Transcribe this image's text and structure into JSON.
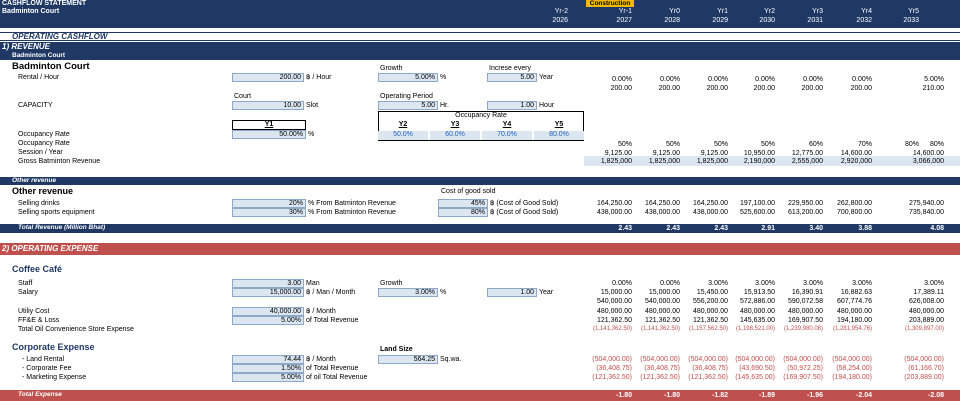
{
  "header": {
    "title": "CASHFLOW STATEMENT",
    "subtitle": "Badminton Court",
    "construction": "Construction",
    "years": [
      {
        "label": "Yr-2",
        "year": "2026"
      },
      {
        "label": "Yr-1",
        "year": "2027"
      },
      {
        "label": "Yr0",
        "year": "2028"
      },
      {
        "label": "Yr1",
        "year": "2029"
      },
      {
        "label": "Yr2",
        "year": "2030"
      },
      {
        "label": "Yr3",
        "year": "2031"
      },
      {
        "label": "Yr4",
        "year": "2032"
      },
      {
        "label": "Yr5",
        "year": "2033"
      }
    ]
  },
  "operating_cashflow": {
    "title": "OPERATING CASHFLOW",
    "revenue_title": "1)  REVENUE",
    "revenue_sub": "Badminton Court",
    "section": "Badminton Court",
    "rental_label": "Rental / Hour",
    "rental_value": "200.00",
    "rental_unit": "฿ / Hour",
    "growth_label": "Growth",
    "growth_value": "5.00%",
    "growth_unit": "%",
    "increase_label": "Increse every",
    "increase_value": "5.00",
    "increase_unit": "Year",
    "rental_pct": [
      "0.00%",
      "0.00%",
      "0.00%",
      "0.00%",
      "0.00%",
      "0.00%",
      "5.00%"
    ],
    "rental_vals": [
      "200.00",
      "200.00",
      "200.00",
      "200.00",
      "200.00",
      "200.00",
      "210.00"
    ],
    "court_label": "Court",
    "capacity_label": "CAPACITY",
    "capacity_value": "10.00",
    "capacity_unit": "Slot",
    "op_period_label": "Operating Period",
    "op_period_value": "5.00",
    "op_period_unit": "Hr.",
    "op_hour_value": "1.00",
    "op_hour_unit": "Hour",
    "occ_rate_header": "Occupancy Rate",
    "occ_years": [
      "Y1",
      "Y2",
      "Y3",
      "Y4",
      "Y5"
    ],
    "occ_values": [
      "50.00%",
      "50.0%",
      "60.0%",
      "70.0%",
      "80.0%"
    ],
    "occ_unit": "%",
    "occ_label1": "Occupancy Rate",
    "occ_label2": "Occupancy Rate",
    "occ_row": [
      "50%",
      "50%",
      "50%",
      "50%",
      "60%",
      "70%",
      "80%",
      "80%"
    ],
    "session_label": "Session / Year",
    "session_row": [
      "9,125.00",
      "9,125.00",
      "9,125.00",
      "10,950.00",
      "12,775.00",
      "14,600.00",
      "14,600.00"
    ],
    "gross_label": "Gross Batminton Revenue",
    "gross_row": [
      "1,825,000",
      "1,825,000",
      "1,825,000",
      "2,190,000",
      "2,555,000",
      "2,920,000",
      "3,066,000"
    ]
  },
  "other_revenue": {
    "band": "Other revenue",
    "title": "Other revenue",
    "cogs_label": "Cost of good sold",
    "drinks_label": "Selling drinks",
    "drinks_pct": "20%",
    "drinks_from": "% From Batminton Revenue",
    "drinks_cogs": "45%",
    "drinks_cogs_unit": "฿ (Cost of Good Sold)",
    "drinks_row": [
      "164,250.00",
      "164,250.00",
      "164,250.00",
      "197,100.00",
      "229,950.00",
      "262,800.00",
      "275,940.00"
    ],
    "equip_label": "Selling sports equipment",
    "equip_pct": "30%",
    "equip_from": "% From Batminton Revenue",
    "equip_cogs": "80%",
    "equip_cogs_unit": "฿ (Cost of Good Sold)",
    "equip_row": [
      "438,000.00",
      "438,000.00",
      "438,000.00",
      "525,600.00",
      "613,200.00",
      "700,800.00",
      "735,840.00"
    ],
    "total_label": "Total Revenue  (Million Bhat)",
    "total_row": [
      "2.43",
      "2.43",
      "2.43",
      "2.91",
      "3.40",
      "3.88",
      "4.08"
    ]
  },
  "operating_expense": {
    "title": "2)  OPERATING EXPENSE",
    "coffee_title": "Coffee Café",
    "staff_label": "Staff",
    "staff_value": "3.00",
    "staff_unit": "Man",
    "growth_label": "Growth",
    "salary_label": "Salary",
    "salary_value": "15,000.00",
    "salary_unit": "฿ / Man / Month",
    "salary_growth": "3.00%",
    "salary_growth_unit": "%",
    "salary_every": "1.00",
    "salary_every_unit": "Year",
    "staff_row": [
      "0.00%",
      "0.00%",
      "3.00%",
      "3.00%",
      "3.00%",
      "3.00%",
      "3.00%"
    ],
    "salary_row": [
      "15,000.00",
      "15,000.00",
      "15,450.00",
      "15,913.50",
      "16,390.91",
      "16,882.63",
      "17,389.11"
    ],
    "salary_total_row": [
      "540,000.00",
      "540,000.00",
      "556,200.00",
      "572,886.00",
      "590,072.58",
      "607,774.76",
      "626,008.00"
    ],
    "utility_label": "Utiliy Cost",
    "utility_value": "40,000.00",
    "utility_unit": "฿ / Month",
    "utility_row": [
      "480,000.00",
      "480,000.00",
      "480,000.00",
      "480,000.00",
      "480,000.00",
      "480,000.00",
      "480,000.00"
    ],
    "ffe_label": "FF&E & Loss",
    "ffe_value": "5.00%",
    "ffe_unit": "of Total Revenue",
    "ffe_row": [
      "121,362.50",
      "121,362.50",
      "121,362.50",
      "145,635.00",
      "169,907.50",
      "194,180.00",
      "203,889.00"
    ],
    "total_oil_label": "Total Oil Convenience Store Expense",
    "total_oil_row": [
      "(1,141,362.50)",
      "(1,141,362.50)",
      "(1,157,562.50)",
      "(1,198,521.00)",
      "(1,239,980.08)",
      "(1,281,954.76)",
      "(1,309,897.00)"
    ],
    "corp_title": "Corporate Expense",
    "land_size_label": "Land Size",
    "land_label": "- Land Rental",
    "land_value": "74.44",
    "land_unit": "฿ / Month",
    "land_size_value": "564.25",
    "land_size_unit": "Sq.wa.",
    "land_row": [
      "(504,000.00)",
      "(504,000.00)",
      "(504,000.00)",
      "(504,000.00)",
      "(504,000.00)",
      "(504,000.00)",
      "(504,000.00)"
    ],
    "corp_fee_label": "- Corporate Fee",
    "corp_fee_value": "1.50%",
    "corp_fee_unit": "of Total Revenue",
    "corp_fee_row": [
      "(36,408.75)",
      "(36,408.75)",
      "(36,408.75)",
      "(43,690.50)",
      "(50,972.25)",
      "(58,254.00)",
      "(61,166.70)"
    ],
    "mkt_label": "- Marketing Expense",
    "mkt_value": "5.00%",
    "mkt_unit": "of oil Total Revenue",
    "mkt_row": [
      "(121,362.50)",
      "(121,362.50)",
      "(121,362.50)",
      "(145,635.00)",
      "(169,907.50)",
      "(194,180.00)",
      "(203,889.00)"
    ],
    "total_label": "Total Expense",
    "total_row": [
      "-1.80",
      "-1.80",
      "-1.82",
      "-1.89",
      "-1.96",
      "-2.04",
      "-2.08"
    ]
  }
}
